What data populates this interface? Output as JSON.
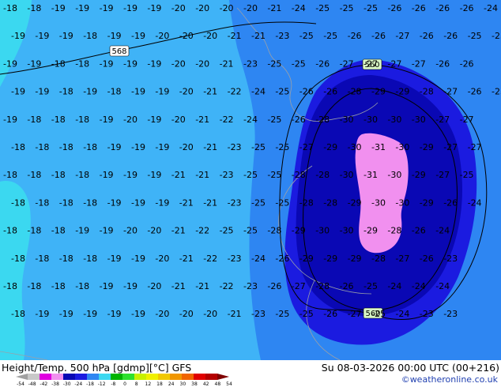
{
  "map": {
    "fill_colors": {
      "minus_14_18": "#3bd8f0",
      "minus_18_22": "#3fb3f7",
      "minus_22_26": "#2e86f2",
      "minus_26_30": "#1b1be0",
      "minus_30_34": "#0a08b4",
      "below_minus_34": "#f190ef",
      "contour_line": "#000000",
      "coastline": "#9aa0a8"
    },
    "contour_labels": [
      "568",
      "560",
      "560"
    ],
    "temperature_rows": [
      [
        -18,
        -18,
        -19,
        -19,
        -19,
        -19,
        -19,
        -20,
        -20,
        -20,
        -20,
        -21,
        -24,
        -25,
        -25,
        -25,
        -26,
        -26,
        -26,
        -26,
        -24
      ],
      [
        -19,
        -19,
        -19,
        -18,
        -19,
        -19,
        -20,
        -20,
        -20,
        -21,
        -21,
        -23,
        -25,
        -25,
        -26,
        -26,
        -27,
        -26,
        -26,
        -25,
        -25
      ],
      [
        -19,
        -19,
        -18,
        -18,
        -19,
        -19,
        -19,
        -20,
        -20,
        -21,
        -23,
        -25,
        -25,
        -26,
        -27,
        -27,
        -27,
        -27,
        -26,
        -26
      ],
      [
        -19,
        -19,
        -18,
        -19,
        -18,
        -19,
        -19,
        -20,
        -21,
        -22,
        -24,
        -25,
        -26,
        -26,
        -28,
        -29,
        -29,
        -28,
        -27,
        -26,
        -25
      ],
      [
        -19,
        -18,
        -18,
        -18,
        -19,
        -20,
        -19,
        -20,
        -21,
        -22,
        -24,
        -25,
        -26,
        -28,
        -30,
        -30,
        -30,
        -30,
        -27,
        -27
      ],
      [
        -18,
        -18,
        -18,
        -18,
        -19,
        -19,
        -19,
        -20,
        -21,
        -23,
        -25,
        -25,
        -27,
        -29,
        -30,
        -31,
        -30,
        -29,
        -27,
        -27
      ],
      [
        -18,
        -18,
        -18,
        -18,
        -19,
        -19,
        -19,
        -21,
        -21,
        -23,
        -25,
        -25,
        -28,
        -28,
        -30,
        -31,
        -30,
        -29,
        -27,
        -25
      ],
      [
        -18,
        -18,
        -18,
        -18,
        -19,
        -19,
        -19,
        -21,
        -21,
        -23,
        -25,
        -25,
        -28,
        -28,
        -29,
        -30,
        -30,
        -29,
        -26,
        -24
      ],
      [
        -18,
        -18,
        -18,
        -19,
        -19,
        -20,
        -20,
        -21,
        -22,
        -25,
        -25,
        -28,
        -29,
        -30,
        -30,
        -29,
        -28,
        -26,
        -24
      ],
      [
        -18,
        -18,
        -18,
        -18,
        -19,
        -19,
        -20,
        -21,
        -22,
        -23,
        -24,
        -26,
        -29,
        -29,
        -29,
        -28,
        -27,
        -26,
        -23
      ],
      [
        -18,
        -18,
        -18,
        -18,
        -19,
        -19,
        -20,
        -21,
        -21,
        -22,
        -23,
        -26,
        -27,
        -28,
        -26,
        -25,
        -24,
        -24,
        -24
      ],
      [
        -18,
        -19,
        -19,
        -19,
        -19,
        -19,
        -20,
        -20,
        -20,
        -21,
        -23,
        -25,
        -25,
        -26,
        -27,
        -25,
        -24,
        -23,
        -23
      ]
    ]
  },
  "footer": {
    "title_left": "Height/Temp. 500 hPa [gdmp][°C] GFS",
    "title_right": "Su 08-03-2026 00:00 UTC (00+216)",
    "credit": "©weatheronline.co.uk",
    "colorbar": {
      "ticks": [
        "-54",
        "-48",
        "-42",
        "-38",
        "-30",
        "-24",
        "-18",
        "-12",
        "-8",
        "0",
        "8",
        "12",
        "18",
        "24",
        "30",
        "38",
        "42",
        "48",
        "54"
      ],
      "colors": [
        "#a0a0a0",
        "#c8c8c8",
        "#e000e0",
        "#f190ef",
        "#0a08b4",
        "#1b1be0",
        "#2e86f2",
        "#3bd8f0",
        "#00b400",
        "#2ee02e",
        "#c8f000",
        "#f0f000",
        "#f0c800",
        "#f09600",
        "#f06400",
        "#e00000",
        "#b40000",
        "#800000"
      ]
    }
  }
}
